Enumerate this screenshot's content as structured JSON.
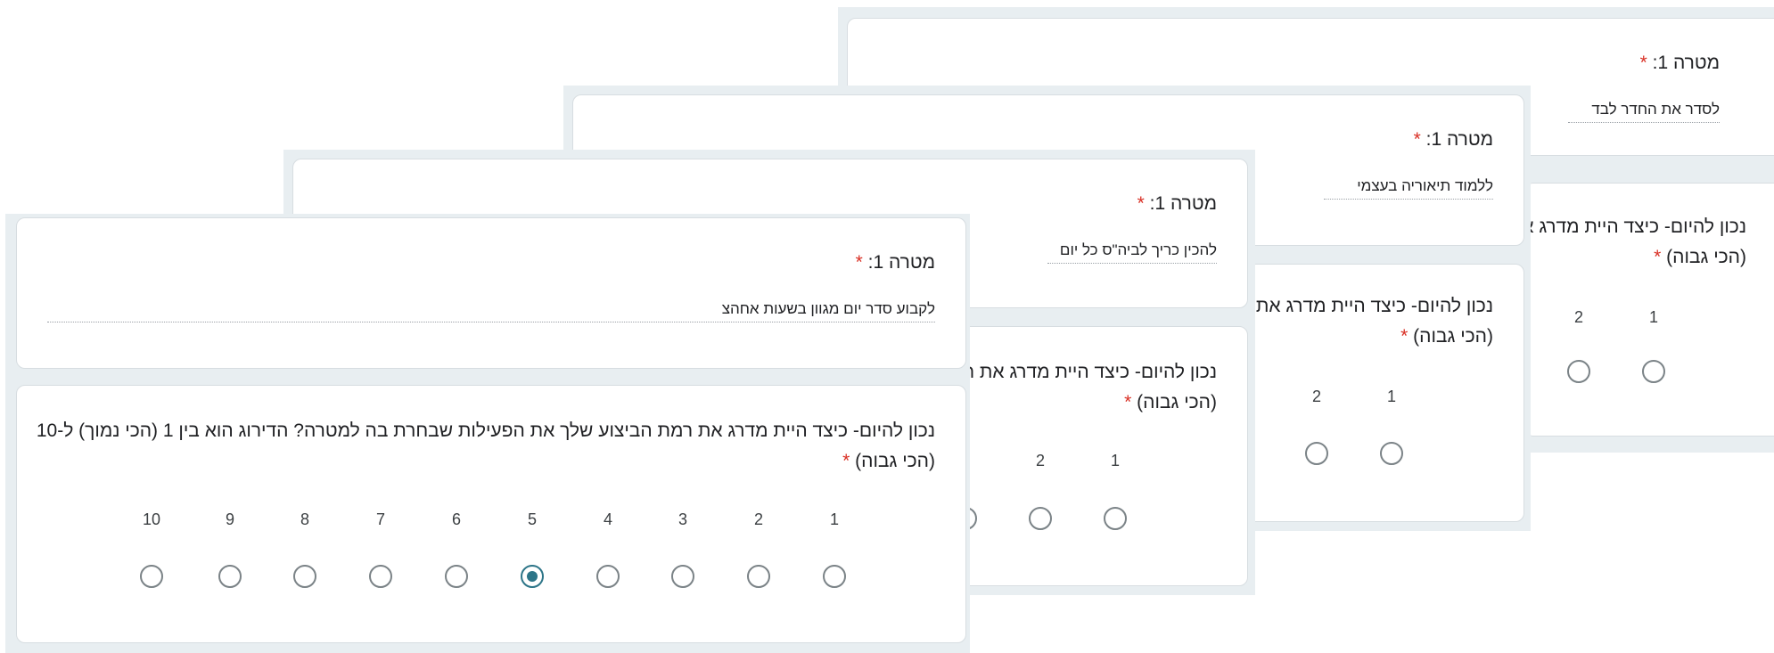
{
  "forms": [
    {
      "goal_label": "מטרה 1:",
      "answer": "לסדר את החדר לבד",
      "question_line1": "נכון להיום- כיצד היית מדרג א",
      "question_line2": "(הכי גבוה)",
      "scale": [
        "2",
        "1"
      ],
      "selected": null
    },
    {
      "goal_label": "מטרה 1:",
      "answer": "ללמוד תיאוריה בעצמי",
      "question_line1": "נכון להיום- כיצד היית מדרג את",
      "question_line2": "(הכי גבוה)",
      "scale": [
        "2",
        "1"
      ],
      "selected": null
    },
    {
      "goal_label": "מטרה 1:",
      "answer": "להכין כריך לביה\"ס כל יום",
      "question_line1": "נכון להיום- כיצד היית מדרג את ר",
      "question_line2": "(הכי גבוה)",
      "scale": [
        "2",
        "1"
      ],
      "selected": null
    },
    {
      "goal_label": "מטרה 1:",
      "answer": "לקבוע סדר יום מגוון בשעות אחהצ",
      "question_line1": "נכון להיום- כיצד היית מדרג את רמת הביצוע שלך את הפעילות שבחרת בה למטרה? הדירוג הוא בין 1 (הכי נמוך) ל-10",
      "question_line2": "(הכי גבוה)",
      "scale": [
        "10",
        "9",
        "8",
        "7",
        "6",
        "5",
        "4",
        "3",
        "2",
        "1"
      ],
      "selected": "5"
    }
  ],
  "required_mark": "*",
  "colors": {
    "accent": "#2d7588",
    "required": "#d93025",
    "frame": "#e8eef1"
  }
}
